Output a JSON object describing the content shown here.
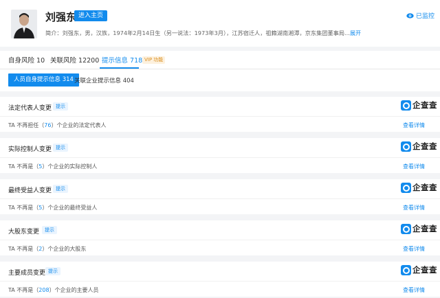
{
  "profile": {
    "name": "刘强东",
    "home_button": "进入主页",
    "intro": "简介：刘强东，男，汉族，1974年2月14日生（另一说法：1973年3月），江苏宿迁人，祖籍湖南湘潭，京东集团董事局...",
    "expand": "展开",
    "monitor": "已监控"
  },
  "tabs": [
    {
      "label": "自身风险 10"
    },
    {
      "label": "关联风险 12200"
    },
    {
      "label": "提示信息 718"
    }
  ],
  "vip_badge": "VIP 功能",
  "subtabs": {
    "active": "人员自身提示信息 314",
    "other": "关联企业提示信息 404"
  },
  "logo_text": "企查查",
  "sections": [
    {
      "title": "法定代表人变更",
      "badge": "提示",
      "pre": "TA 不再担任（",
      "num": "76",
      "post": "）个企业的法定代表人",
      "link": "查看详情"
    },
    {
      "title": "实际控制人变更",
      "badge": "提示",
      "pre": "TA 不再是（",
      "num": "5",
      "post": "）个企业的实际控制人",
      "link": "查看详情"
    },
    {
      "title": "最终受益人变更",
      "badge": "提示",
      "pre": "TA 不再是（",
      "num": "5",
      "post": "）个企业的最终受益人",
      "link": "查看详情"
    },
    {
      "title": "大股东变更",
      "badge": "提示",
      "pre": "TA 不再是（",
      "num": "2",
      "post": "）个企业的大股东",
      "link": "查看详情"
    },
    {
      "title": "主要成员变更",
      "badge": "提示",
      "pre": "TA 不再是（",
      "num": "208",
      "post": "）个企业的主要人员",
      "link": "查看详情"
    }
  ]
}
